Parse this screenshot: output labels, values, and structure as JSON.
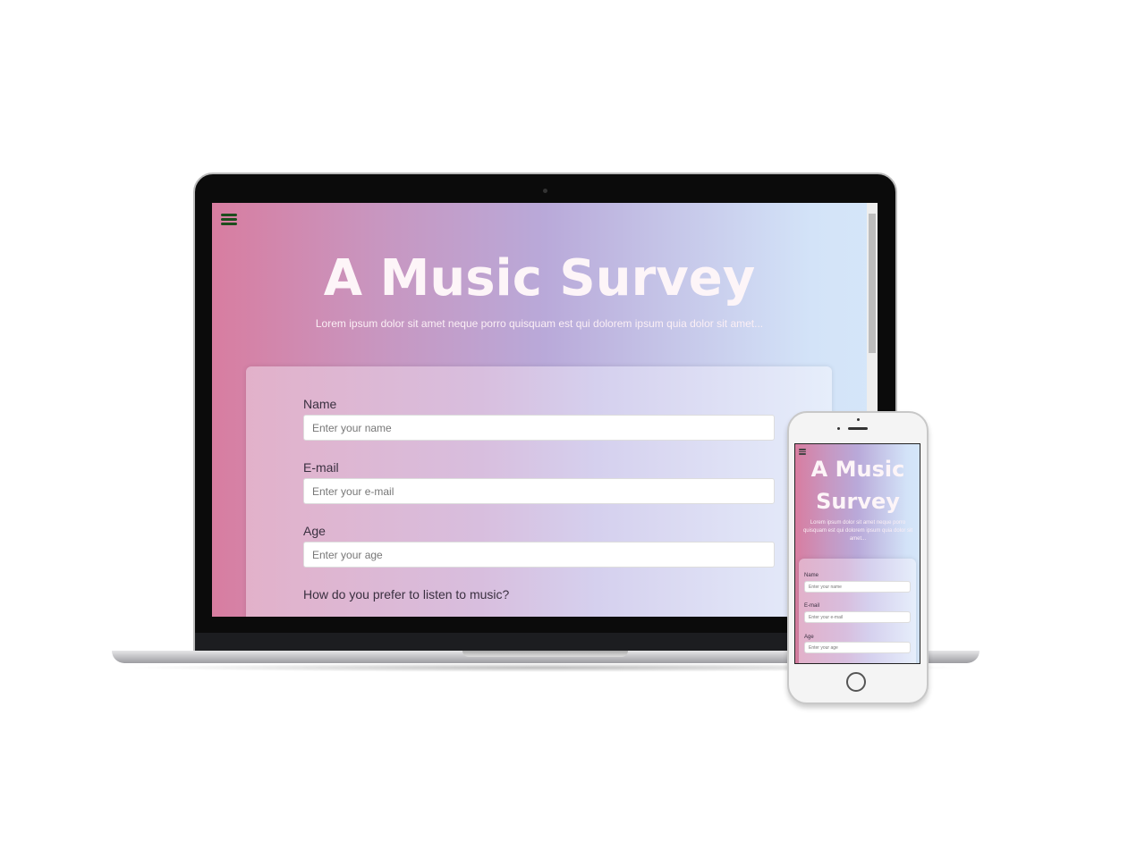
{
  "page": {
    "title": "A Music Survey",
    "subtitle": "Lorem ipsum dolor sit amet neque porro quisquam est qui dolorem ipsum quia dolor sit amet...",
    "fields": [
      {
        "label": "Name",
        "placeholder": "Enter your name"
      },
      {
        "label": "E-mail",
        "placeholder": "Enter your e-mail"
      },
      {
        "label": "Age",
        "placeholder": "Enter your age"
      }
    ],
    "question": "How do you prefer to listen to music?"
  },
  "icons": {
    "menu": "hamburger-menu-icon"
  }
}
